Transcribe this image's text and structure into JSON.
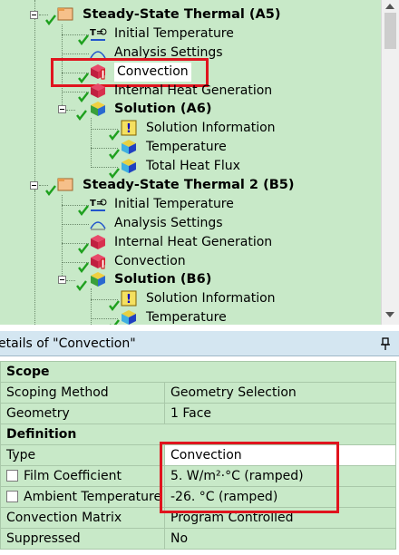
{
  "tree": {
    "items": [
      {
        "label": "Steady-State Thermal (A5)",
        "bold": true
      },
      {
        "label": "Initial Temperature"
      },
      {
        "label": "Analysis Settings"
      },
      {
        "label": "Convection",
        "selected": true
      },
      {
        "label": "Internal Heat Generation"
      },
      {
        "label": "Solution (A6)",
        "bold": true
      },
      {
        "label": "Solution Information"
      },
      {
        "label": "Temperature"
      },
      {
        "label": "Total Heat Flux"
      },
      {
        "label": "Steady-State Thermal 2 (B5)",
        "bold": true
      },
      {
        "label": "Initial Temperature"
      },
      {
        "label": "Analysis Settings"
      },
      {
        "label": "Internal Heat Generation"
      },
      {
        "label": "Convection"
      },
      {
        "label": "Solution (B6)",
        "bold": true
      },
      {
        "label": "Solution Information"
      },
      {
        "label": "Temperature"
      }
    ]
  },
  "details": {
    "title": "etails of \"Convection\"",
    "scope_header": "Scope",
    "definition_header": "Definition",
    "rows": [
      {
        "name": "Scoping Method",
        "value": "Geometry Selection"
      },
      {
        "name": "Geometry",
        "value": "1 Face"
      },
      {
        "name": "Type",
        "value": "Convection"
      },
      {
        "name": "Film Coefficient",
        "value": "5. W/m²·°C  (ramped)"
      },
      {
        "name": "Ambient Temperature",
        "value": "-26. °C  (ramped)"
      },
      {
        "name": "Convection Matrix",
        "value": "Program Controlled"
      },
      {
        "name": "Suppressed",
        "value": "No"
      }
    ]
  },
  "colors": {
    "tree_bg": "#c8e9c8",
    "highlight": "#e0141e",
    "title_bar": "#d4e6f1"
  }
}
